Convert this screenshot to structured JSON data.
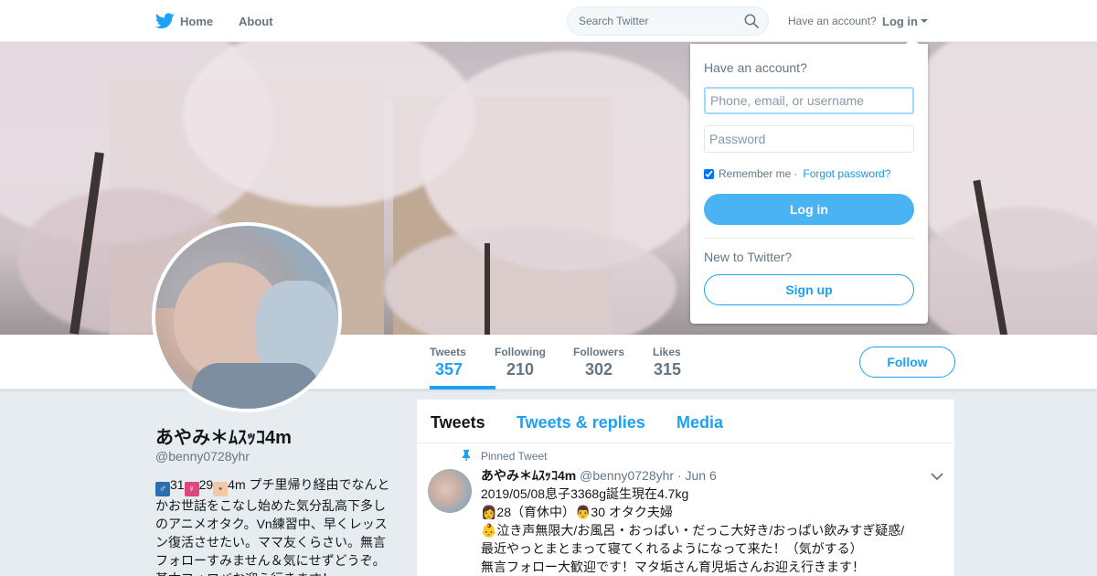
{
  "topnav": {
    "home_label": "Home",
    "about_label": "About",
    "search_placeholder": "Search Twitter",
    "have_account": "Have an account?",
    "login_label": "Log in"
  },
  "profile_nav": {
    "stats": [
      {
        "label": "Tweets",
        "value": "357"
      },
      {
        "label": "Following",
        "value": "210"
      },
      {
        "label": "Followers",
        "value": "302"
      },
      {
        "label": "Likes",
        "value": "315"
      }
    ],
    "follow_label": "Follow"
  },
  "profile": {
    "name": "あやみ＊ﾑｽｯｺ4m",
    "handle": "@benny0728yhr",
    "bio_parts": [
      "31",
      "29",
      "4m プチ里帰り経由でなんとかお世話をこなし始めた気分乱高下多しのアニメオタク。Vn練習中、早くレッスン復活させたい。ママ友くらさい。無言フォローすみません＆気にせずどうぞ。基本フォロバお迎え行きます！"
    ]
  },
  "timeline": {
    "tabs": [
      "Tweets",
      "Tweets & replies",
      "Media"
    ],
    "pinned_label": "Pinned Tweet",
    "tweet": {
      "name": "あやみ＊ﾑｽｯｺ4m",
      "meta": "@benny0728yhr · Jun 6",
      "body": "2019/05/08息子3368g誕生現在4.7kg\n👩28（育休中）👨30 オタク夫婦\n👶泣き声無限大/お風呂・おっぱい・だっこ大好き/おっぱい飲みすぎ疑惑/\n 最近やっとまとまって寝てくれるようになって来た！（気がする）\n無言フォロー大歓迎です！マタ垢さん育児垢さんお迎え行きます！"
    }
  },
  "login_dropdown": {
    "title": "Have an account?",
    "username_placeholder": "Phone, email, or username",
    "password_placeholder": "Password",
    "remember_label": "Remember me",
    "forgot_label": "Forgot password?",
    "login_button": "Log in",
    "new_label": "New to Twitter?",
    "signup_button": "Sign up"
  },
  "colors": {
    "accent": "#1da1f2",
    "login_button": "#4ab3f4",
    "background": "#e6ecf0"
  },
  "icons": [
    "twitter-bird-icon",
    "search-icon",
    "caret-down-icon",
    "pin-icon",
    "chevron-down-icon",
    "checkbox-icon"
  ]
}
